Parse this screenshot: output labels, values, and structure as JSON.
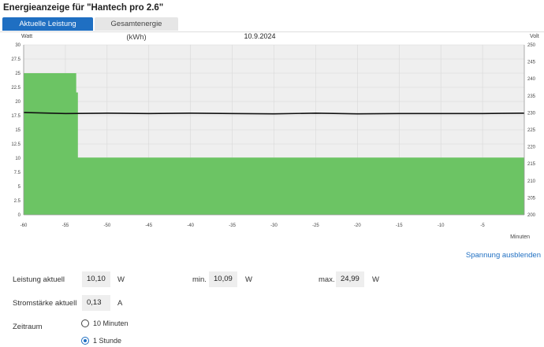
{
  "page": {
    "title": "Energieanzeige für \"Hantech pro 2.6\""
  },
  "tabs": [
    {
      "label": "Aktuelle Leistung (Watt)",
      "active": true
    },
    {
      "label": "Gesamtenergie (kWh)",
      "active": false
    }
  ],
  "chart_data": {
    "type": "area",
    "title": "10.9.2024",
    "left_axis_label": "Watt",
    "right_axis_label": "Volt",
    "xlabel": "Minuten",
    "xlim": [
      -60,
      0
    ],
    "x_ticks": [
      "-60",
      "-55",
      "-50",
      "-45",
      "-40",
      "-35",
      "-30",
      "-25",
      "-20",
      "-15",
      "-10",
      "-5"
    ],
    "y_left_lim": [
      0,
      30
    ],
    "y_left_ticks": [
      "0",
      "2.5",
      "5",
      "7.5",
      "10",
      "12.5",
      "15",
      "17.5",
      "20",
      "22.5",
      "25",
      "27.5",
      "30"
    ],
    "y_right_lim": [
      200,
      250
    ],
    "y_right_ticks": [
      "200",
      "205",
      "210",
      "215",
      "220",
      "225",
      "230",
      "235",
      "240",
      "245",
      "250"
    ],
    "grid": true,
    "series": [
      {
        "name": "Leistung",
        "axis": "left",
        "color": "#6cc464",
        "points": [
          [
            -60,
            25.0
          ],
          [
            -53.7,
            25.0
          ],
          [
            -53.7,
            21.6
          ],
          [
            -53.5,
            21.6
          ],
          [
            -53.5,
            10.1
          ],
          [
            0,
            10.1
          ]
        ]
      },
      {
        "name": "Spannung",
        "axis": "right",
        "color": "#111111",
        "points": [
          [
            -60,
            230.1
          ],
          [
            -55,
            229.8
          ],
          [
            -50,
            229.9
          ],
          [
            -45,
            229.8
          ],
          [
            -40,
            229.9
          ],
          [
            -35,
            229.8
          ],
          [
            -30,
            229.7
          ],
          [
            -25,
            229.9
          ],
          [
            -20,
            229.7
          ],
          [
            -15,
            229.8
          ],
          [
            -10,
            229.8
          ],
          [
            -5,
            229.8
          ],
          [
            0,
            229.9
          ]
        ]
      }
    ]
  },
  "voltage_link": "Spannung ausblenden",
  "stats": {
    "leistung_label": "Leistung aktuell",
    "leistung_value": "10,10",
    "leistung_unit": "W",
    "min_label": "min.",
    "min_value": "10,09",
    "min_unit": "W",
    "max_label": "max.",
    "max_value": "24,99",
    "max_unit": "W",
    "strom_label": "Stromstärke aktuell",
    "strom_value": "0,13",
    "strom_unit": "A"
  },
  "zeitraum": {
    "label": "Zeitraum",
    "options": [
      {
        "label": "10 Minuten",
        "checked": false
      },
      {
        "label": "1 Stunde",
        "checked": true
      }
    ]
  }
}
